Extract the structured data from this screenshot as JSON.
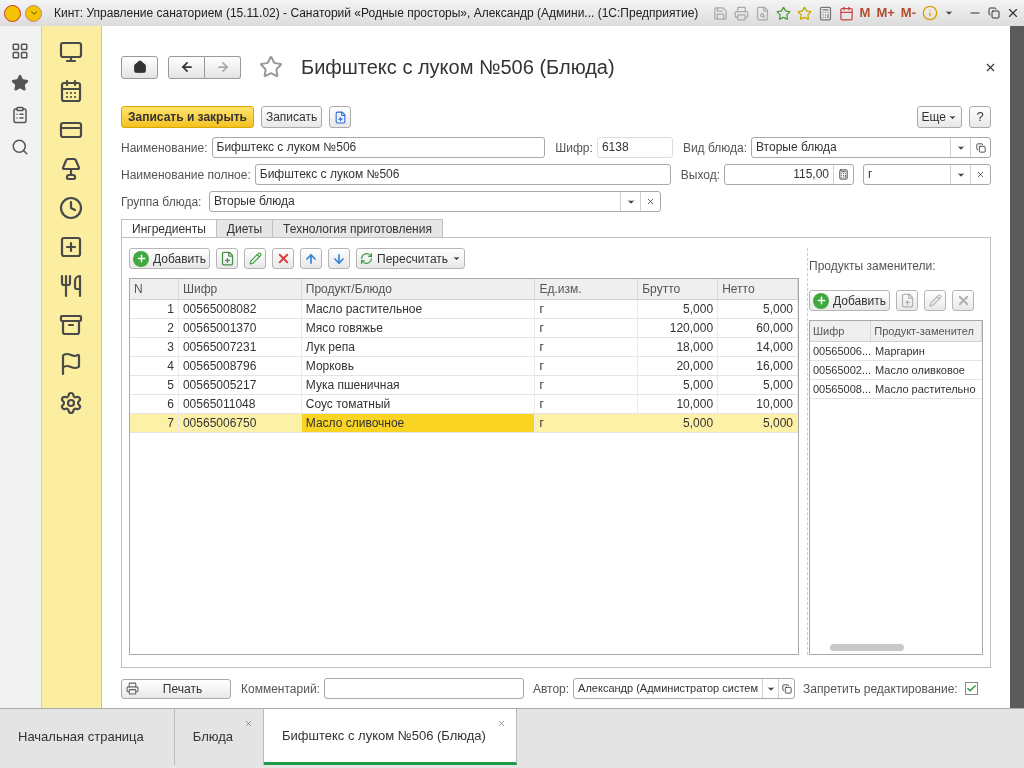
{
  "window": {
    "title": "Кинт: Управление санаторием (15.11.02) - Санаторий «Родные просторы», Александр (Админи...  (1С:Предприятие)",
    "memory_buttons": [
      "M",
      "M+",
      "M-"
    ]
  },
  "form": {
    "title": "Бифштекс с луком №506 (Блюда)",
    "commands": {
      "save_close": "Записать и закрыть",
      "save": "Записать",
      "more": "Еще",
      "help": "?"
    },
    "fields": {
      "name": {
        "label": "Наименование:",
        "value": "Бифштекс с луком №506"
      },
      "code": {
        "label": "Шифр:",
        "value": "6138"
      },
      "dish_type": {
        "label": "Вид блюда:",
        "value": "Вторые блюда"
      },
      "full_name": {
        "label": "Наименование полное:",
        "value": "Бифштекс с луком №506"
      },
      "yield": {
        "label": "Выход:",
        "value": "115,00"
      },
      "unit": {
        "value": "г"
      },
      "group": {
        "label": "Группа блюда:",
        "value": "Вторые блюда"
      }
    },
    "tabs": [
      {
        "label": "Ингредиенты",
        "selected": true
      },
      {
        "label": "Диеты",
        "selected": false
      },
      {
        "label": "Технология приготовления",
        "selected": false
      }
    ],
    "ingredients": {
      "toolbar": [
        {
          "kind": "add",
          "label": "Добавить",
          "disabled": false
        },
        {
          "kind": "copy",
          "disabled": false
        },
        {
          "kind": "edit",
          "disabled": false
        },
        {
          "kind": "delete",
          "disabled": false
        },
        {
          "kind": "up",
          "disabled": false
        },
        {
          "kind": "down",
          "disabled": false
        },
        {
          "kind": "recalc",
          "label": "Пересчитать",
          "disabled": false
        }
      ],
      "columns": [
        "N",
        "Шифр",
        "Продукт/Блюдо",
        "Ед.изм.",
        "Брутто",
        "Нетто"
      ],
      "rows": [
        {
          "cells": [
            "1",
            "00565008082",
            "Масло растительное",
            "г",
            "5,000",
            "5,000"
          ],
          "selected": false
        },
        {
          "cells": [
            "2",
            "00565001370",
            "Мясо говяжье",
            "г",
            "120,000",
            "60,000"
          ],
          "selected": false
        },
        {
          "cells": [
            "3",
            "00565007231",
            "Лук репа",
            "г",
            "18,000",
            "14,000"
          ],
          "selected": false
        },
        {
          "cells": [
            "4",
            "00565008796",
            "Морковь",
            "г",
            "20,000",
            "16,000"
          ],
          "selected": false
        },
        {
          "cells": [
            "5",
            "00565005217",
            "Мука пшеничная",
            "г",
            "5,000",
            "5,000"
          ],
          "selected": false
        },
        {
          "cells": [
            "6",
            "00565011048",
            "Соус томатный",
            "г",
            "10,000",
            "10,000"
          ],
          "selected": false
        },
        {
          "cells": [
            "7",
            "00565006750",
            "Масло сливочное",
            "г",
            "5,000",
            "5,000"
          ],
          "selected": true
        }
      ]
    },
    "substitutes": {
      "title": "Продукты заменители:",
      "toolbar": [
        {
          "kind": "add",
          "label": "Добавить",
          "disabled": false
        },
        {
          "kind": "copy",
          "disabled": true
        },
        {
          "kind": "edit",
          "disabled": true
        },
        {
          "kind": "delete",
          "disabled": true
        }
      ],
      "columns": [
        "Шифр",
        "Продукт-заменител"
      ],
      "rows": [
        {
          "cells": [
            "00565006...",
            "Маргарин"
          ],
          "selected": false
        },
        {
          "cells": [
            "00565002...",
            "Масло оливковое"
          ],
          "selected": false
        },
        {
          "cells": [
            "00565008...",
            "Масло растительно"
          ],
          "selected": false
        }
      ]
    },
    "footer": {
      "print": "Печать",
      "comment": {
        "label": "Комментарий:"
      },
      "author": {
        "label": "Автор:",
        "value": "Александр (Администратор систем"
      },
      "lock": {
        "label": "Запретить редактирование:",
        "checked": true
      }
    }
  },
  "open_tabs": [
    {
      "label": "Начальная страница",
      "selected": false,
      "closable": false
    },
    {
      "label": "Блюда",
      "selected": false,
      "closable": true
    },
    {
      "label": "Бифштекс с луком №506 (Блюда)",
      "selected": true,
      "closable": true
    }
  ]
}
